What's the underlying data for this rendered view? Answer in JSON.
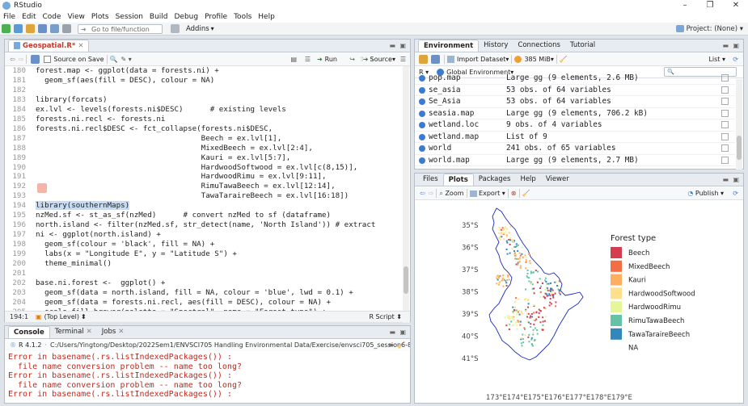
{
  "window": {
    "title": "RStudio"
  },
  "menu": [
    "File",
    "Edit",
    "Code",
    "View",
    "Plots",
    "Session",
    "Build",
    "Debug",
    "Profile",
    "Tools",
    "Help"
  ],
  "toolbar": {
    "goto_placeholder": "Go to file/function",
    "addins": "Addins",
    "project": "Project: (None)"
  },
  "editor": {
    "tab_label": "Geospatial.R*",
    "source_on_save": "Source on Save",
    "run_label": "Run",
    "source_label": "Source",
    "lines": [
      {
        "n": "180",
        "t": "forest.map <- ggplot(data = forests.ni) +"
      },
      {
        "n": "181",
        "t": "  geom_sf(aes(fill = DESC), colour = NA)"
      },
      {
        "n": "182",
        "t": ""
      },
      {
        "n": "183",
        "t": "library(forcats)"
      },
      {
        "n": "184",
        "t": "ex.lvl <- levels(forests.ni$DESC)      # existing levels"
      },
      {
        "n": "185",
        "t": "forests.ni.recl <- forests.ni"
      },
      {
        "n": "186",
        "t": "forests.ni.recl$DESC <- fct_collapse(forests.ni$DESC,"
      },
      {
        "n": "187",
        "t": "                                     Beech = ex.lvl[1],"
      },
      {
        "n": "188",
        "t": "                                     MixedBeech = ex.lvl[2:4],"
      },
      {
        "n": "189",
        "t": "                                     Kauri = ex.lvl[5:7],"
      },
      {
        "n": "190",
        "t": "                                     HardwoodSoftwood = ex.lvl[c(8,15)],"
      },
      {
        "n": "191",
        "t": "                                     HardwoodRimu = ex.lvl[9:11],"
      },
      {
        "n": "192",
        "t": "                                     RimuTawaBeech = ex.lvl[12:14],"
      },
      {
        "n": "193",
        "t": "                                     TawaTaraireBeech = ex.lvl[16:18])"
      },
      {
        "n": "194",
        "t": "library(southernMaps)"
      },
      {
        "n": "195",
        "t": "nzMed.sf <- st_as_sf(nzMed)      # convert nzMed to sf (dataframe)"
      },
      {
        "n": "196",
        "t": "north.island <- filter(nzMed.sf, str_detect(name, 'North Island')) # extract"
      },
      {
        "n": "197",
        "t": "ni <- ggplot(north.island) +"
      },
      {
        "n": "198",
        "t": "  geom_sf(colour = 'black', fill = NA) +"
      },
      {
        "n": "199",
        "t": "  labs(x = \"Longitude E\", y = \"Latitude S\") +"
      },
      {
        "n": "200",
        "t": "  theme_minimal()"
      },
      {
        "n": "201",
        "t": ""
      },
      {
        "n": "202",
        "t": "base.ni.forest <-  ggplot() +"
      },
      {
        "n": "203",
        "t": "  geom_sf(data = north.island, fill = NA, colour = 'blue', lwd = 0.1) +"
      },
      {
        "n": "204",
        "t": "  geom_sf(data = forests.ni.recl, aes(fill = DESC), colour = NA) +"
      },
      {
        "n": "205",
        "t": "  scale_fill_brewer(palette = \"Spectral\", name = \"Forest type\") +"
      }
    ],
    "status_pos": "194:1",
    "status_scope": "(Top Level)",
    "status_type": "R Script"
  },
  "console": {
    "tabs": [
      "Console",
      "Terminal",
      "Jobs"
    ],
    "version": "R 4.1.2",
    "path": "C:/Users/Yingtong/Desktop/2022Sem1/ENVSCI705 Handling Environmental Data/Exercise/envsci705_session6-8/",
    "lines": [
      "Error in basename(.rs.listIndexedPackages()) :",
      "  file name conversion problem -- name too long?",
      "Error in basename(.rs.listIndexedPackages()) :",
      "  file name conversion problem -- name too long?",
      "Error in basename(.rs.listIndexedPackages()) :"
    ]
  },
  "env": {
    "tabs": [
      "Environment",
      "History",
      "Connections",
      "Tutorial"
    ],
    "import_label": "Import Dataset",
    "memory": "385 MiB",
    "list_label": "List",
    "r_label": "R",
    "global_env": "Global Environment",
    "rows": [
      {
        "name": "pop.map",
        "value": "Large gg (9 elements,   2.6 MB)"
      },
      {
        "name": "se_asia",
        "value": "53 obs. of 64 variables"
      },
      {
        "name": "Se_Asia",
        "value": "53 obs. of 64 variables"
      },
      {
        "name": "seasia.map",
        "value": "Large gg (9 elements,   706.2 kB)"
      },
      {
        "name": "wetland.loc",
        "value": "9 obs. of 4 variables"
      },
      {
        "name": "wetland.map",
        "value": "List of  9"
      },
      {
        "name": "world",
        "value": "241 obs. of 65 variables"
      },
      {
        "name": "world.map",
        "value": "Large gg (9 elements,   2.7 MB)"
      }
    ]
  },
  "plots": {
    "tabs": [
      "Files",
      "Plots",
      "Packages",
      "Help",
      "Viewer"
    ],
    "zoom": "Zoom",
    "export": "Export",
    "publish": "Publish",
    "legend_title": "Forest type",
    "legend": [
      {
        "name": "Beech",
        "color": "#d53e4f"
      },
      {
        "name": "MixedBeech",
        "color": "#f46d43"
      },
      {
        "name": "Kauri",
        "color": "#fdae61"
      },
      {
        "name": "HardwoodSoftwood",
        "color": "#fee08b"
      },
      {
        "name": "HardwoodRimu",
        "color": "#e6f598"
      },
      {
        "name": "RimuTawaBeech",
        "color": "#66c2a5"
      },
      {
        "name": "TawaTaraireBeech",
        "color": "#3288bd"
      },
      {
        "name": "NA",
        "color": ""
      }
    ],
    "y_ticks": [
      "35°S",
      "36°S",
      "37°S",
      "38°S",
      "39°S",
      "40°S",
      "41°S"
    ],
    "x_ticks_text": "173°E174°E175°E176°E177°E178°E179°E"
  }
}
